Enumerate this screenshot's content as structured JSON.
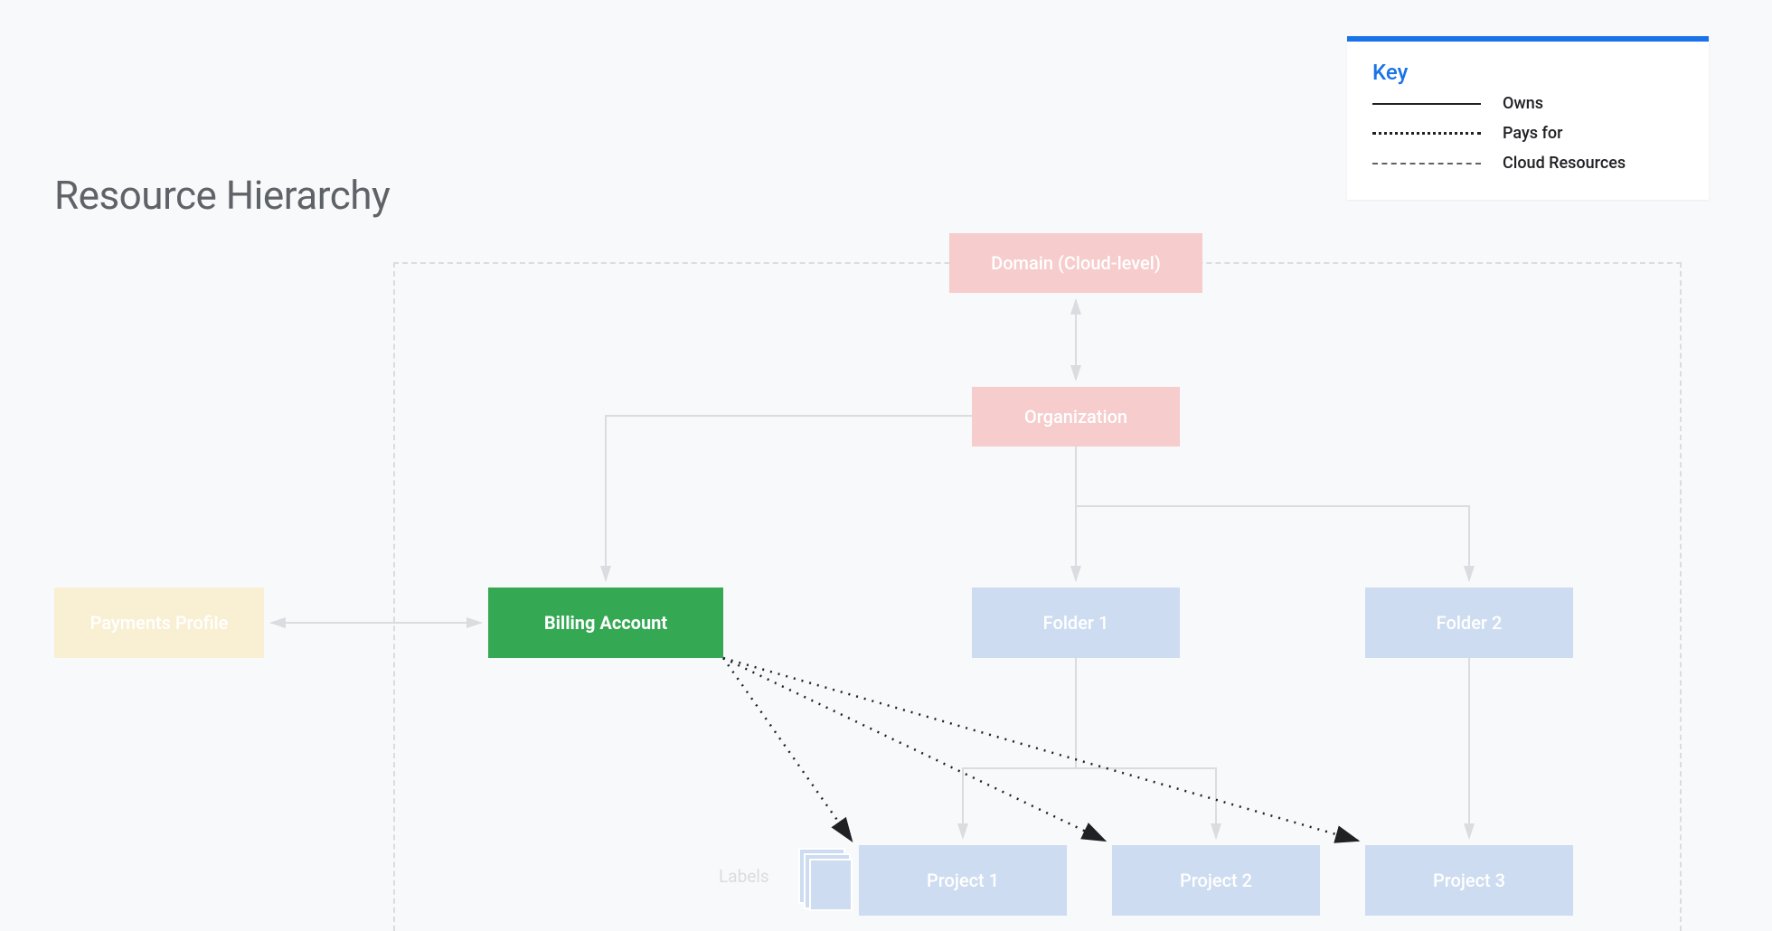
{
  "title": "Resource Hierarchy",
  "legend": {
    "title": "Key",
    "items": [
      {
        "style": "solid",
        "label": "Owns"
      },
      {
        "style": "dotted",
        "label": "Pays for"
      },
      {
        "style": "dashed",
        "label": "Cloud Resources"
      }
    ]
  },
  "nodes": {
    "domain": "Domain (Cloud-level)",
    "organization": "Organization",
    "payments_profile": "Payments Profile",
    "billing_account": "Billing Account",
    "folder1": "Folder 1",
    "folder2": "Folder 2",
    "project1": "Project 1",
    "project2": "Project 2",
    "project3": "Project 3",
    "labels": "Labels"
  },
  "colors": {
    "red_faded": "#f6cccc",
    "blue_faded": "#cddcf0",
    "yellow_faded": "#f9efd2",
    "green_highlight": "#34a853",
    "accent_blue": "#1a73e8",
    "line_faded": "#dadce0",
    "line_dark": "#202124"
  },
  "highlighted": "billing_account"
}
